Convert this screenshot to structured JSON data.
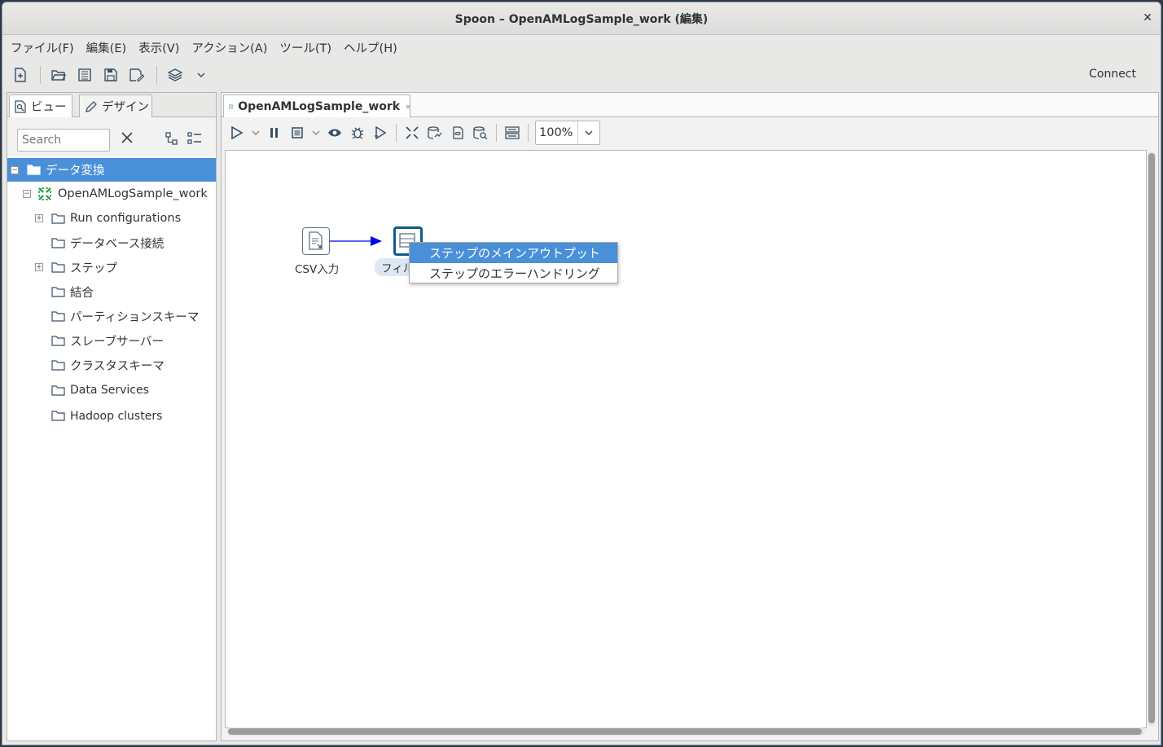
{
  "window": {
    "title": "Spoon – OpenAMLogSample_work (編集)"
  },
  "menubar": [
    "ファイル(F)",
    "編集(E)",
    "表示(V)",
    "アクション(A)",
    "ツール(T)",
    "ヘルプ(H)"
  ],
  "toolbar": {
    "connect_label": "Connect"
  },
  "left_panel": {
    "tabs": [
      {
        "label": "ビュー",
        "icon": "view-icon"
      },
      {
        "label": "デザイン",
        "icon": "pencil-icon"
      }
    ],
    "search_placeholder": "Search",
    "tree": [
      {
        "label": "データ変換",
        "selected": true
      },
      {
        "label": "OpenAMLogSample_work"
      },
      {
        "label": "Run configurations"
      },
      {
        "label": "データベース接続"
      },
      {
        "label": "ステップ"
      },
      {
        "label": "結合"
      },
      {
        "label": "パーティションスキーマ"
      },
      {
        "label": "スレーブサーバー"
      },
      {
        "label": "クラスタスキーマ"
      },
      {
        "label": "Data Services"
      },
      {
        "label": "Hadoop clusters"
      }
    ]
  },
  "editor": {
    "tab_label": "OpenAMLogSample_work",
    "zoom": "100%",
    "steps": [
      {
        "label": "CSV入力"
      },
      {
        "label": "フィル"
      }
    ],
    "hop_color": "#0000ee",
    "context_menu": [
      {
        "label": "ステップのメインアウトプット",
        "active": true
      },
      {
        "label": "ステップのエラーハンドリング",
        "active": false
      }
    ]
  },
  "colors": {
    "selection": "#4a90d9",
    "accent_green": "#2e9e4a"
  }
}
